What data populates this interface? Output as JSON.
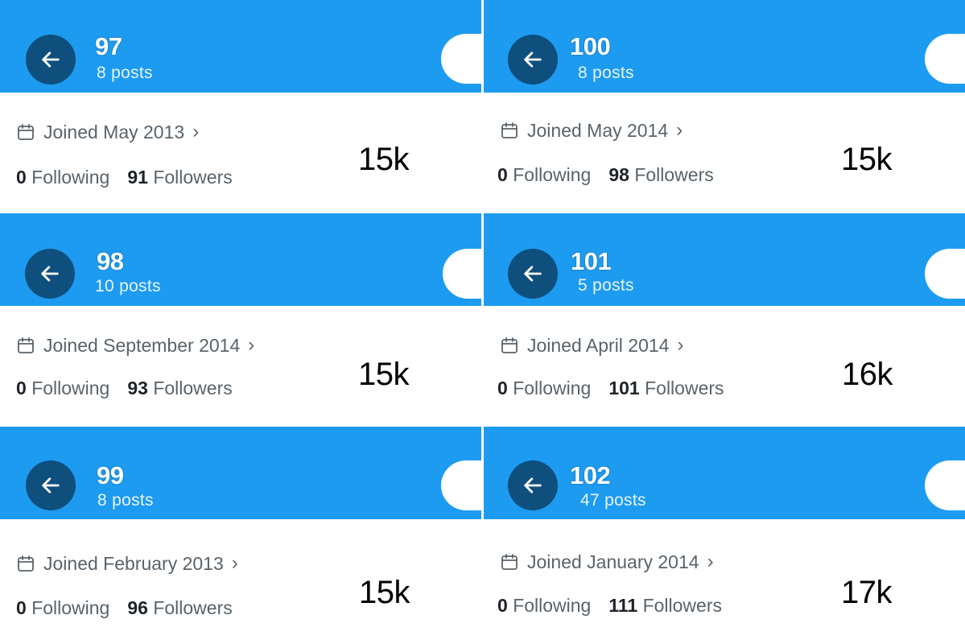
{
  "panels": [
    {
      "name": "97",
      "posts": "8 posts",
      "joined": "Joined May 2013",
      "following_count": "0",
      "following_label": "Following",
      "followers_count": "91",
      "followers_label": "Followers",
      "views": "15k"
    },
    {
      "name": "100",
      "posts": "8 posts",
      "joined": "Joined May 2014",
      "following_count": "0",
      "following_label": "Following",
      "followers_count": "98",
      "followers_label": "Followers",
      "views": "15k"
    },
    {
      "name": "98",
      "posts": "10 posts",
      "joined": "Joined September 2014",
      "following_count": "0",
      "following_label": "Following",
      "followers_count": "93",
      "followers_label": "Followers",
      "views": "15k"
    },
    {
      "name": "101",
      "posts": "5 posts",
      "joined": "Joined April 2014",
      "following_count": "0",
      "following_label": "Following",
      "followers_count": "101",
      "followers_label": "Followers",
      "views": "16k"
    },
    {
      "name": "99",
      "posts": "8 posts",
      "joined": "Joined February 2013",
      "following_count": "0",
      "following_label": "Following",
      "followers_count": "96",
      "followers_label": "Followers",
      "views": "15k"
    },
    {
      "name": "102",
      "posts": "47 posts",
      "joined": "Joined January 2014",
      "following_count": "0",
      "following_label": "Following",
      "followers_count": "111",
      "followers_label": "Followers",
      "views": "17k"
    }
  ],
  "icons": {
    "back": "arrow-left-icon",
    "calendar": "calendar-icon",
    "chevron": "chevron-right-icon"
  },
  "colors": {
    "header": "#1d9bf0",
    "back_button": "#0f4f7e",
    "muted_text": "#59636b"
  }
}
